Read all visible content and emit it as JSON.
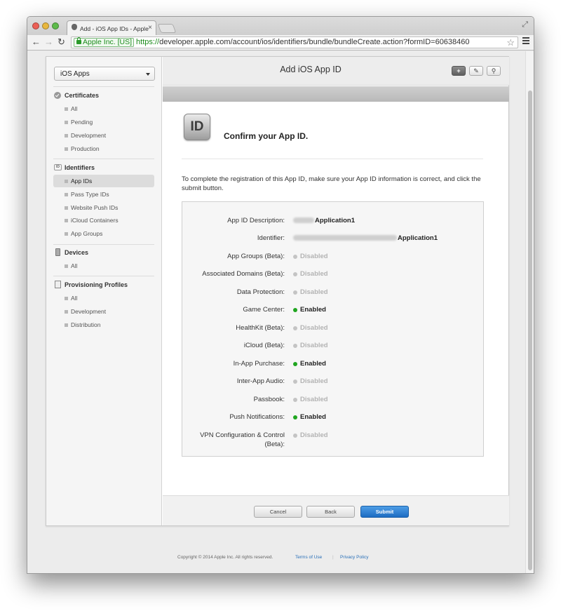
{
  "browser": {
    "tab_title": "Add - iOS App IDs - Apple",
    "tab_close": "×",
    "ev_label": "Apple Inc. [US]",
    "url_protocol": "https://",
    "url_rest": "developer.apple.com/account/ios/identifiers/bundle/bundleCreate.action?formID=60638460",
    "back_glyph": "←",
    "forward_glyph": "→",
    "reload_glyph": "↻",
    "star_glyph": "☆",
    "fullscreen_glyph": "⤢"
  },
  "sidebar": {
    "platform_select": "iOS Apps",
    "sections": [
      {
        "header": "Certificates",
        "icon": "certificate-icon",
        "items": [
          "All",
          "Pending",
          "Development",
          "Production"
        ]
      },
      {
        "header": "Identifiers",
        "icon": "id-icon",
        "items": [
          "App IDs",
          "Pass Type IDs",
          "Website Push IDs",
          "iCloud Containers",
          "App Groups"
        ]
      },
      {
        "header": "Devices",
        "icon": "device-icon",
        "items": [
          "All"
        ]
      },
      {
        "header": "Provisioning Profiles",
        "icon": "document-icon",
        "items": [
          "All",
          "Development",
          "Distribution"
        ]
      }
    ],
    "active_item": "App IDs"
  },
  "header": {
    "title": "Add iOS App ID",
    "add_glyph": "+",
    "edit_glyph": "✎",
    "search_glyph": "⚲"
  },
  "confirm": {
    "badge": "ID",
    "heading": "Confirm your App ID.",
    "instructions": "To complete the registration of this App ID, make sure your App ID information is correct, and click the submit button."
  },
  "details": {
    "description_label": "App ID Description:",
    "description_value": "Application1",
    "identifier_label": "Identifier:",
    "identifier_value": "Application1",
    "services": [
      {
        "label": "App Groups (Beta):",
        "status": "Disabled"
      },
      {
        "label": "Associated Domains (Beta):",
        "status": "Disabled"
      },
      {
        "label": "Data Protection:",
        "status": "Disabled"
      },
      {
        "label": "Game Center:",
        "status": "Enabled"
      },
      {
        "label": "HealthKit (Beta):",
        "status": "Disabled"
      },
      {
        "label": "iCloud (Beta):",
        "status": "Disabled"
      },
      {
        "label": "In-App Purchase:",
        "status": "Enabled"
      },
      {
        "label": "Inter-App Audio:",
        "status": "Disabled"
      },
      {
        "label": "Passbook:",
        "status": "Disabled"
      },
      {
        "label": "Push Notifications:",
        "status": "Enabled"
      },
      {
        "label": "VPN Configuration & Control (Beta):",
        "status": "Disabled"
      }
    ],
    "colors": {
      "enabled": "#1fa51f",
      "disabled": "#c4c4c4"
    }
  },
  "buttons": {
    "cancel": "Cancel",
    "back": "Back",
    "submit": "Submit"
  },
  "footer": {
    "copyright": "Copyright © 2014 Apple Inc. All rights reserved.",
    "terms": "Terms of Use",
    "separator": "|",
    "privacy": "Privacy Policy"
  }
}
